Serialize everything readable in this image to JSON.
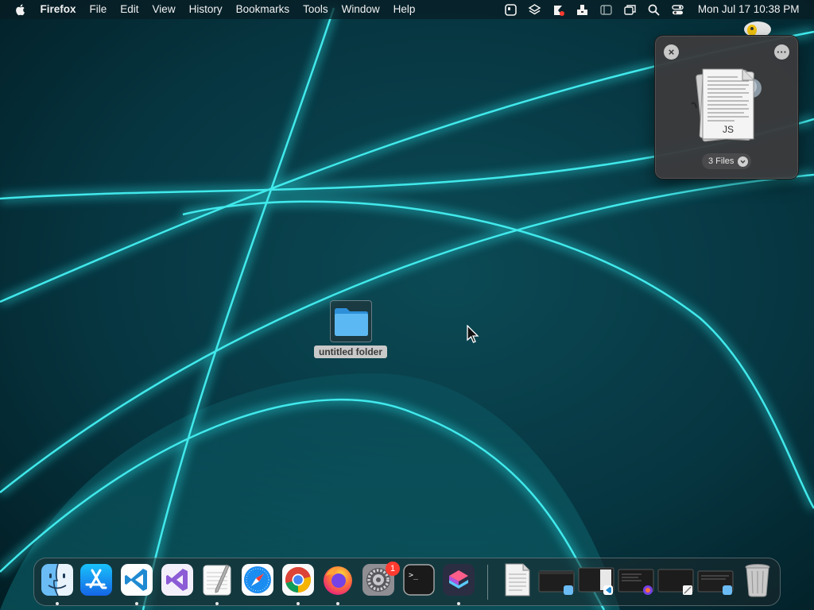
{
  "menubar": {
    "app_name": "Firefox",
    "menus": [
      "File",
      "Edit",
      "View",
      "History",
      "Bookmarks",
      "Tools",
      "Window",
      "Help"
    ],
    "clock": "Mon Jul 17  10:38 PM",
    "status_icons": [
      "screen-icon",
      "layers-icon",
      "tracker-icon",
      "archive-icon",
      "sidebar-icon",
      "windows-icon",
      "spotlight-icon",
      "control-center-icon"
    ]
  },
  "drop_panel": {
    "file_badge": "JS",
    "files_count": "3 Files",
    "close_icon": "close-icon",
    "more_icon": "more-icon"
  },
  "desktop": {
    "folder_label": "untitled folder"
  },
  "dock": {
    "apps": [
      {
        "name": "Finder",
        "icon": "finder-icon",
        "running": true
      },
      {
        "name": "App Store",
        "icon": "app-store-icon",
        "running": false
      },
      {
        "name": "Visual Studio Code",
        "icon": "vscode-icon",
        "running": true
      },
      {
        "name": "Visual Studio",
        "icon": "visual-studio-icon",
        "running": false
      },
      {
        "name": "TextEdit",
        "icon": "textedit-icon",
        "running": true
      },
      {
        "name": "Safari",
        "icon": "safari-icon",
        "running": false
      },
      {
        "name": "Google Chrome",
        "icon": "chrome-icon",
        "running": true
      },
      {
        "name": "Firefox",
        "icon": "firefox-icon",
        "running": true
      },
      {
        "name": "System Settings",
        "icon": "settings-icon",
        "running": false
      },
      {
        "name": "Terminal",
        "icon": "terminal-icon",
        "running": false
      },
      {
        "name": "Shortcuts",
        "icon": "shortcuts-icon",
        "running": true
      }
    ],
    "settings_badge": "1",
    "terminal_prompt": ">_",
    "minimized": [
      "document-icon",
      "finder-window-thumbnail",
      "vscode-window-thumbnail",
      "firefox-window-thumbnail",
      "textedit-window-thumbnail",
      "finder-window-thumbnail-2"
    ],
    "trash": "trash-icon"
  },
  "colors": {
    "wallpaper_base": "#04262e",
    "glow": "#2ee6e6",
    "badge": "#ff3b30"
  }
}
